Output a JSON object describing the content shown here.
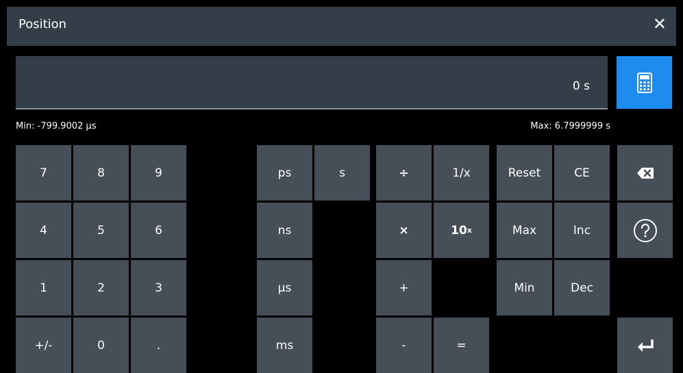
{
  "dialog": {
    "title": "Position"
  },
  "display": {
    "value": "0 s",
    "min": "Min: -799.9002 µs",
    "max": "Max: 6.7999999 s"
  },
  "keys": {
    "k7": "7",
    "k8": "8",
    "k9": "9",
    "k4": "4",
    "k5": "5",
    "k6": "6",
    "k1": "1",
    "k2": "2",
    "k3": "3",
    "sign": "+/-",
    "k0": "0",
    "dot": ".",
    "ps": "ps",
    "s": "s",
    "ns": "ns",
    "us": "µs",
    "ms": "ms",
    "div": "÷",
    "recip": "1/x",
    "mul": "×",
    "pow_base": "10",
    "pow_exp": "x",
    "plus": "+",
    "minus": "-",
    "equals": "=",
    "reset": "Reset",
    "ce": "CE",
    "max": "Max",
    "inc": "Inc",
    "min": "Min",
    "dec": "Dec"
  },
  "colors": {
    "titlebar": "#333e48",
    "key": "#464f58",
    "accent": "#1e8bf0"
  },
  "icons": {
    "close": "close-icon",
    "calculator": "calculator-icon",
    "backspace": "backspace-icon",
    "help": "help-icon",
    "enter": "enter-icon"
  }
}
